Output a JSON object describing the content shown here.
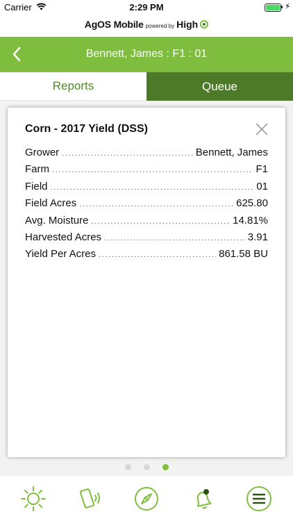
{
  "status_bar": {
    "carrier": "Carrier",
    "time": "2:29 PM",
    "battery_level": 1.0,
    "icons": [
      "wifi-icon",
      "battery-icon",
      "charging-bolt-icon"
    ]
  },
  "brand": {
    "app_name": "AgOS Mobile",
    "powered_by": "powered by",
    "company": "High"
  },
  "header": {
    "title": "Bennett, James : F1 : 01",
    "back_icon": "chevron-left-icon"
  },
  "tabs": [
    {
      "label": "Reports",
      "active": false
    },
    {
      "label": "Queue",
      "active": true
    }
  ],
  "card": {
    "title": "Corn - 2017 Yield (DSS)",
    "close_icon": "close-icon",
    "rows": [
      {
        "label": "Grower",
        "value": "Bennett, James"
      },
      {
        "label": "Farm",
        "value": "F1"
      },
      {
        "label": "Field",
        "value": "01"
      },
      {
        "label": "Field Acres",
        "value": "625.80"
      },
      {
        "label": "Avg. Moisture",
        "value": "14.81%"
      },
      {
        "label": "Harvested Acres",
        "value": "3.91"
      },
      {
        "label": "Yield Per Acres",
        "value": "861.58 BU"
      }
    ]
  },
  "pager": {
    "count": 3,
    "active_index": 2
  },
  "bottom_nav": [
    {
      "icon": "sun-icon"
    },
    {
      "icon": "phone-signal-icon"
    },
    {
      "icon": "compass-icon"
    },
    {
      "icon": "bell-notification-icon"
    },
    {
      "icon": "menu-icon"
    }
  ],
  "colors": {
    "accent_green": "#7ebd3e",
    "dark_green": "#4c7a28",
    "tab_text_green": "#4f8a27"
  }
}
